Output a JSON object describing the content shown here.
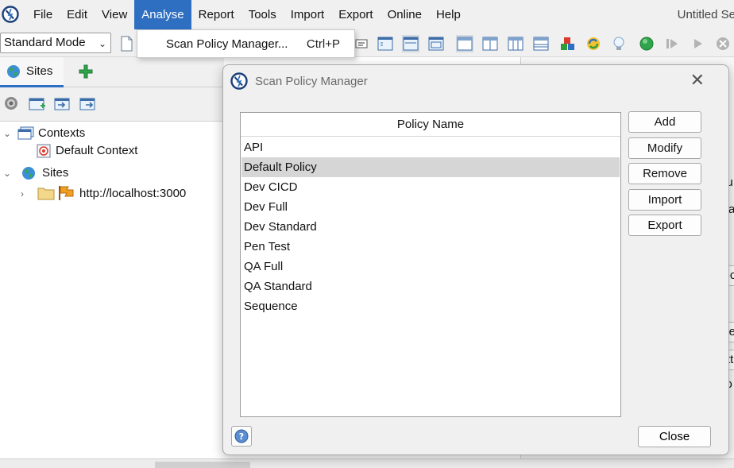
{
  "menubar": {
    "items": [
      "File",
      "Edit",
      "View",
      "Analyse",
      "Report",
      "Tools",
      "Import",
      "Export",
      "Online",
      "Help"
    ],
    "active": "Analyse",
    "window_title": "Untitled Se"
  },
  "toolbar": {
    "mode": "Standard Mode"
  },
  "dropdown": {
    "label": "Scan Policy Manager...",
    "shortcut": "Ctrl+P"
  },
  "sites_panel": {
    "tab_label": "Sites",
    "tree": {
      "contexts_label": "Contexts",
      "default_context_label": "Default Context",
      "sites_label": "Sites",
      "site_url": "http://localhost:3000"
    }
  },
  "background_fragments": [
    "au",
    "ly a",
    "/loc",
    "ode",
    "Att",
    "co"
  ],
  "dialog": {
    "title": "Scan Policy Manager",
    "column_header": "Policy Name",
    "policies": [
      "API",
      "Default Policy",
      "Dev CICD",
      "Dev Full",
      "Dev Standard",
      "Pen Test",
      "QA Full",
      "QA Standard",
      "Sequence"
    ],
    "selected_policy": "Default Policy",
    "buttons": {
      "add": "Add",
      "modify": "Modify",
      "remove": "Remove",
      "import": "Import",
      "export": "Export",
      "close": "Close"
    }
  },
  "colors": {
    "accent": "#2e6fc2",
    "selection": "#d6d6d6",
    "chrome": "#f0f0f0"
  }
}
